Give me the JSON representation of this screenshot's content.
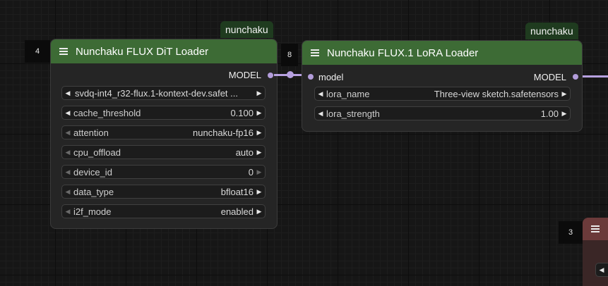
{
  "nodes": [
    {
      "id": "4",
      "badge": "nunchaku",
      "title": "Nunchaku FLUX DiT Loader",
      "output": "MODEL",
      "widgets": [
        {
          "name": "",
          "value": "svdq-int4_r32-flux.1-kontext-dev.safet ..."
        },
        {
          "name": "cache_threshold",
          "value": "0.100"
        },
        {
          "name": "attention",
          "value": "nunchaku-fp16"
        },
        {
          "name": "cpu_offload",
          "value": "auto"
        },
        {
          "name": "device_id",
          "value": "0"
        },
        {
          "name": "data_type",
          "value": "bfloat16"
        },
        {
          "name": "i2f_mode",
          "value": "enabled"
        }
      ]
    },
    {
      "id": "8",
      "badge": "nunchaku",
      "title": "Nunchaku FLUX.1 LoRA Loader",
      "input": "model",
      "output": "MODEL",
      "widgets": [
        {
          "name": "lora_name",
          "value": "Three-view sketch.safetensors"
        },
        {
          "name": "lora_strength",
          "value": "1.00"
        }
      ]
    },
    {
      "id": "3"
    }
  ],
  "colors": {
    "header": "#3d6b35",
    "badge": "#1f3b1f",
    "link": "#b7a1e0",
    "partial_node_header": "#6b3a3a"
  },
  "icons": [
    "hamburger-menu-icon",
    "arrow-left-icon",
    "arrow-right-icon"
  ]
}
